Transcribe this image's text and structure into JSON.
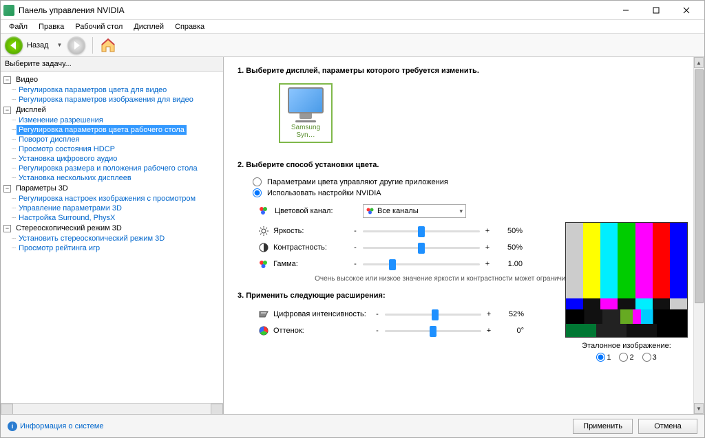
{
  "window": {
    "title": "Панель управления NVIDIA"
  },
  "menu": {
    "file": "Файл",
    "edit": "Правка",
    "desktop": "Рабочий стол",
    "display": "Дисплей",
    "help": "Справка"
  },
  "toolbar": {
    "back": "Назад"
  },
  "sidebar": {
    "header": "Выберите задачу...",
    "groups": [
      {
        "label": "Видео",
        "items": [
          "Регулировка параметров цвета для видео",
          "Регулировка параметров изображения для видео"
        ]
      },
      {
        "label": "Дисплей",
        "items": [
          "Изменение разрешения",
          "Регулировка параметров цвета рабочего стола",
          "Поворот дисплея",
          "Просмотр состояния HDCP",
          "Установка цифрового аудио",
          "Регулировка размера и положения рабочего стола",
          "Установка нескольких дисплеев"
        ],
        "selectedIndex": 1
      },
      {
        "label": "Параметры 3D",
        "items": [
          "Регулировка настроек изображения с просмотром",
          "Управление параметрами 3D",
          "Настройка Surround, PhysX"
        ]
      },
      {
        "label": "Стереоскопический режим 3D",
        "items": [
          "Установить стереоскопический режим 3D",
          "Просмотр рейтинга игр"
        ]
      }
    ]
  },
  "main": {
    "step1_title": "1. Выберите дисплей, параметры которого требуется изменить.",
    "display_name": "Samsung Syn…",
    "step2_title": "2. Выберите способ установки цвета.",
    "radio_other": "Параметрами цвета управляют другие приложения",
    "radio_nvidia": "Использовать настройки NVIDIA",
    "channel_label": "Цветовой канал:",
    "channel_value": "Все каналы",
    "sliders": {
      "brightness": {
        "label": "Яркость:",
        "value": "50%",
        "pos": 50
      },
      "contrast": {
        "label": "Контрастность:",
        "value": "50%",
        "pos": 50
      },
      "gamma": {
        "label": "Гамма:",
        "value": "1.00",
        "pos": 25
      }
    },
    "hint": "Очень высокое или низкое значение яркости и контрастности может ограничить диапазон гаммы.",
    "step3_title": "3. Применить следующие расширения:",
    "ext_sliders": {
      "vibrance": {
        "label": "Цифровая интенсивность:",
        "value": "52%",
        "pos": 52
      },
      "hue": {
        "label": "Оттенок:",
        "value": "0°",
        "pos": 50
      }
    },
    "ref_caption": "Эталонное изображение:",
    "ref_options": {
      "o1": "1",
      "o2": "2",
      "o3": "3"
    }
  },
  "footer": {
    "sysinfo": "Информация о системе",
    "apply": "Применить",
    "cancel": "Отмена"
  }
}
